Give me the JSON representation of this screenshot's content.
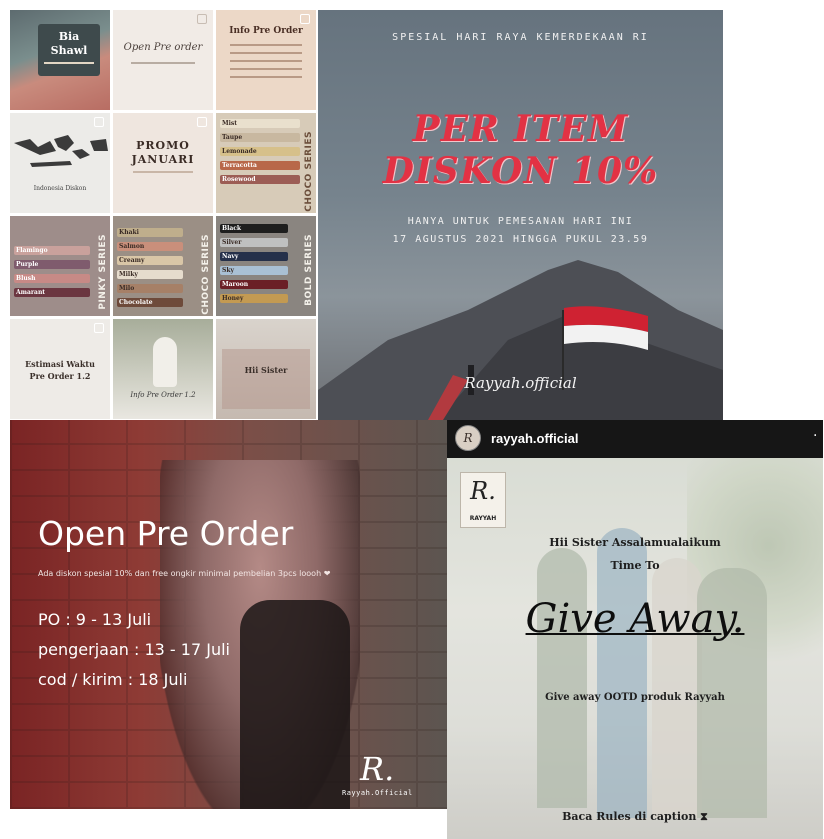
{
  "grid": {
    "r1c1": {
      "line1": "Bia",
      "line2": "Shawl"
    },
    "r1c2": {
      "line1": "Open Pre order"
    },
    "r1c3": {
      "title": "Info Pre Order"
    },
    "r2c1": {
      "caption": "Indonesia Diskon"
    },
    "r2c2": {
      "line1": "PROMO",
      "line2": "JANUARI"
    },
    "r2c3": {
      "items": [
        "Mist",
        "Taupe",
        "Lemonade",
        "Terracotta",
        "Rosewood"
      ],
      "series": "CHOCO SERIES"
    },
    "r3c1": {
      "items": [
        "Flamingo",
        "Purple",
        "Blush",
        "Amarant"
      ],
      "series": "PINKY SERIES"
    },
    "r3c2": {
      "items": [
        "Khaki",
        "Salmon",
        "Creamy",
        "Milky",
        "Milo",
        "Chocolate"
      ],
      "series": "CHOCO SERIES"
    },
    "r3c3": {
      "items": [
        "Black",
        "Silver",
        "Navy",
        "Sky",
        "Maroon",
        "Honey"
      ],
      "series": "BOLD SERIES"
    },
    "r4c1": {
      "line1": "Estimasi Waktu",
      "line2": "Pre Order 1.2"
    },
    "r4c2": {
      "line1": "Info Pre Order 1.2"
    },
    "r4c3": {
      "line1": "Hii Sister"
    }
  },
  "promo": {
    "top_line": "SPESIAL HARI RAYA KEMERDEKAAN RI",
    "headline1": "PER ITEM",
    "headline2": "DISKON 10%",
    "sub1": "HANYA UNTUK PEMESANAN  HARI INI",
    "sub2": "17 AGUSTUS 2021 HINGGA PUKUL 23.59",
    "signature": "Rayyah.official",
    "colors": {
      "bg": "#6f7c87",
      "headline": "#e23244"
    }
  },
  "preorder": {
    "title": "Open Pre Order",
    "desc": "Ada diskon spesial 10% dan free ongkir minimal pembelian 3pcs loooh ❤",
    "line1": "PO : 9 - 13 Juli",
    "line2": "pengerjaan : 13 - 17 Juli",
    "line3": "cod / kirim : 18 Juli",
    "logo_letter": "R.",
    "logo_text": "Rayyah.Official"
  },
  "giveaway": {
    "username": "rayyah.official",
    "logo_letter": "R.",
    "logo_text": "RAYYAH",
    "greeting1": "Hii Sister Assalamualaikum",
    "greeting2": "Time To",
    "headline": "Give Away.",
    "sub": "Give away OOTD produk Rayyah",
    "footer": "Baca Rules di caption ⧗"
  }
}
